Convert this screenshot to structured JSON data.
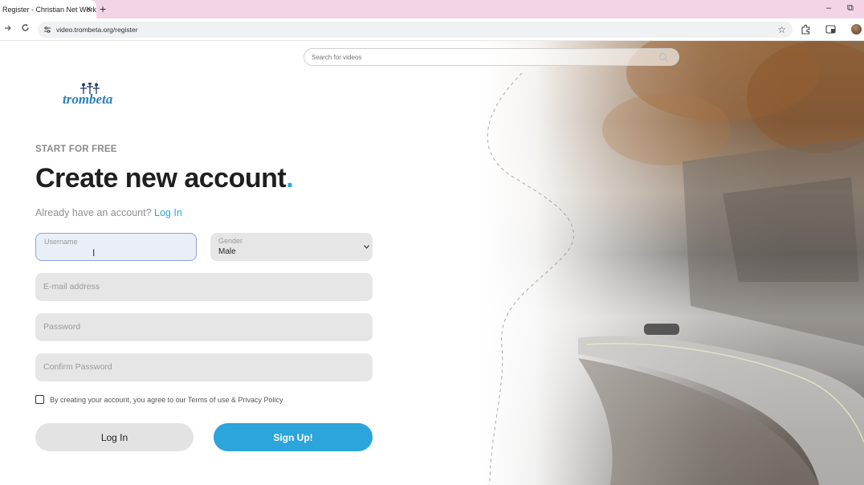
{
  "browser": {
    "tab_title": "Register - Christian Net Work",
    "tab_close": "×",
    "new_tab": "+",
    "url": "video.trombeta.org/register",
    "minimize": "–",
    "restore": "⧉"
  },
  "search": {
    "placeholder": "Search for videos"
  },
  "logo": {
    "text": "trombeta"
  },
  "form": {
    "eyebrow": "START FOR FREE",
    "title": "Create new account",
    "title_dot": ".",
    "already_text": "Already have an account?",
    "login_link": "Log In",
    "username_label": "Username",
    "username_value": "",
    "gender_label": "Gender",
    "gender_value": "Male",
    "email_placeholder": "E-mail address",
    "password_placeholder": "Password",
    "confirm_placeholder": "Confirm Password",
    "terms_text": "By creating your account, you agree to our Terms of use & Privacy Policy",
    "terms_checked": false,
    "login_button": "Log In",
    "signup_button": "Sign Up!"
  },
  "colors": {
    "accent": "#2ba5dc",
    "tabbar": "#f3d3e6"
  }
}
